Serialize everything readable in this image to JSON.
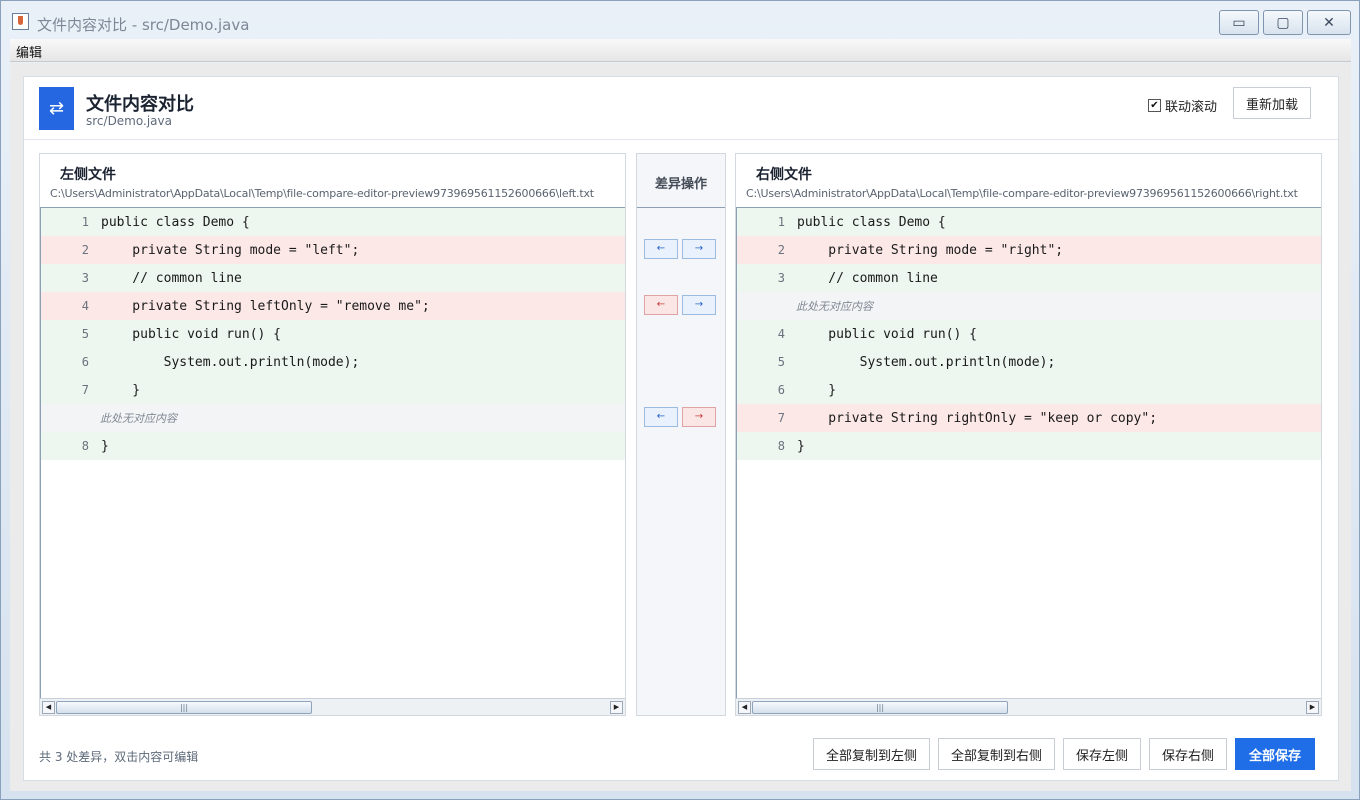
{
  "window": {
    "title": "文件内容对比 - src/Demo.java",
    "minimize_glyph": "▭",
    "maximize_glyph": "▢",
    "close_glyph": "✕"
  },
  "menu": {
    "edit": "编辑"
  },
  "header": {
    "title": "文件内容对比",
    "subtitle": "src/Demo.java",
    "logo_glyph": "⇄",
    "sync_label": "联动滚动",
    "sync_checked": true,
    "sync_check_glyph": "✔",
    "reload_label": "重新加载"
  },
  "left_panel": {
    "title": "左侧文件",
    "path": "C:\\Users\\Administrator\\AppData\\Local\\Temp\\file-compare-editor-preview973969561152600666\\left.txt",
    "lines": [
      {
        "num": "1",
        "text": "public class Demo {",
        "state": "same"
      },
      {
        "num": "2",
        "text": "    private String mode = \"left\";",
        "state": "diff"
      },
      {
        "num": "3",
        "text": "    // common line",
        "state": "same"
      },
      {
        "num": "4",
        "text": "    private String leftOnly = \"remove me\";",
        "state": "diff"
      },
      {
        "num": "5",
        "text": "    public void run() {",
        "state": "same"
      },
      {
        "num": "6",
        "text": "        System.out.println(mode);",
        "state": "same"
      },
      {
        "num": "7",
        "text": "    }",
        "state": "same"
      },
      {
        "num": "",
        "text": "此处无对应内容",
        "state": "gap"
      },
      {
        "num": "8",
        "text": "}",
        "state": "same"
      }
    ]
  },
  "right_panel": {
    "title": "右侧文件",
    "path": "C:\\Users\\Administrator\\AppData\\Local\\Temp\\file-compare-editor-preview973969561152600666\\right.txt",
    "lines": [
      {
        "num": "1",
        "text": "public class Demo {",
        "state": "same"
      },
      {
        "num": "2",
        "text": "    private String mode = \"right\";",
        "state": "diff"
      },
      {
        "num": "3",
        "text": "    // common line",
        "state": "same"
      },
      {
        "num": "",
        "text": "此处无对应内容",
        "state": "gap"
      },
      {
        "num": "4",
        "text": "    public void run() {",
        "state": "same"
      },
      {
        "num": "5",
        "text": "        System.out.println(mode);",
        "state": "same"
      },
      {
        "num": "6",
        "text": "    }",
        "state": "same"
      },
      {
        "num": "7",
        "text": "    private String rightOnly = \"keep or copy\";",
        "state": "diff"
      },
      {
        "num": "8",
        "text": "}",
        "state": "same"
      }
    ]
  },
  "scrollbar": {
    "left_arrow": "◀",
    "right_arrow": "▶",
    "thumb_grip": "|||"
  },
  "ops": {
    "title": "差异操作",
    "rows": [
      {
        "left_glyph": "←",
        "left_color": "blue",
        "right_glyph": "→",
        "right_color": "blue"
      },
      {
        "left_glyph": "←",
        "left_color": "red",
        "right_glyph": "→",
        "right_color": "blue"
      },
      {
        "left_glyph": "←",
        "left_color": "blue",
        "right_glyph": "→",
        "right_color": "red"
      }
    ]
  },
  "footer": {
    "status": "共 3 处差异，双击内容可编辑",
    "copy_all_left": "全部复制到左侧",
    "copy_all_right": "全部复制到右侧",
    "save_left": "保存左侧",
    "save_right": "保存右侧",
    "save_all": "全部保存"
  },
  "colors": {
    "accent": "#1f6ee8",
    "same_bg": "#edf6ef",
    "diff_bg": "#fde8e8",
    "gap_bg": "#f3f4f6"
  }
}
